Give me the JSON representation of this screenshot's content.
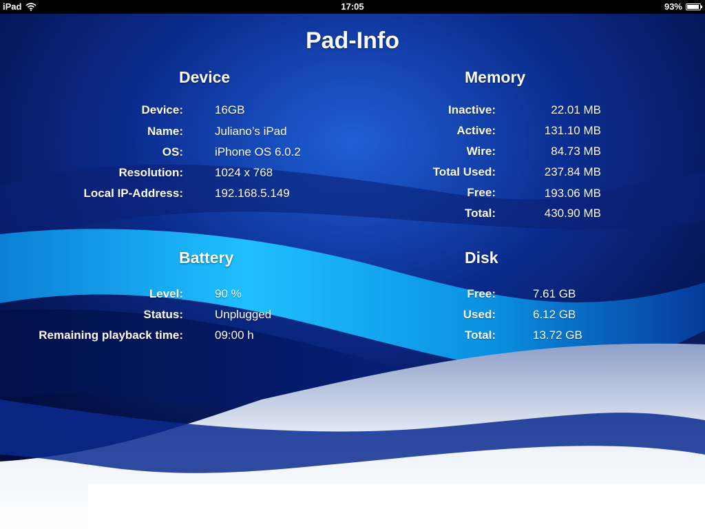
{
  "status_bar": {
    "device": "iPad",
    "time": "17:05",
    "battery_text": "93%",
    "battery_level": 0.93,
    "wifi_icon": "wifi-icon"
  },
  "app": {
    "title": "Pad-Info"
  },
  "device": {
    "heading": "Device",
    "rows": [
      {
        "label": "Device:",
        "value": "16GB"
      },
      {
        "label": "Name:",
        "value": "Juliano’s iPad"
      },
      {
        "label": "OS:",
        "value": "iPhone OS 6.0.2"
      },
      {
        "label": "Resolution:",
        "value": "1024 x 768"
      },
      {
        "label": "Local IP-Address:",
        "value": "192.168.5.149"
      }
    ]
  },
  "memory": {
    "heading": "Memory",
    "rows": [
      {
        "label": "Inactive:",
        "value": "22.01 MB"
      },
      {
        "label": "Active:",
        "value": "131.10 MB"
      },
      {
        "label": "Wire:",
        "value": "84.73 MB"
      },
      {
        "label": "Total Used:",
        "value": "237.84 MB"
      },
      {
        "label": "Free:",
        "value": "193.06 MB"
      },
      {
        "label": "Total:",
        "value": "430.90 MB"
      }
    ]
  },
  "battery": {
    "heading": "Battery",
    "rows": [
      {
        "label": "Level:",
        "value": "90 %"
      },
      {
        "label": "Status:",
        "value": "Unplugged"
      },
      {
        "label": "Remaining playback time:",
        "value": "09:00 h"
      }
    ]
  },
  "disk": {
    "heading": "Disk",
    "rows": [
      {
        "label": "Free:",
        "value": "7.61 GB"
      },
      {
        "label": "Used:",
        "value": "6.12 GB"
      },
      {
        "label": "Total:",
        "value": "13.72 GB"
      }
    ]
  },
  "colors": {
    "background_dark": "#03124f",
    "background_mid": "#0a3aa8",
    "wave_cyan": "#0aa6ee",
    "wave_white": "#e6ebf5"
  }
}
